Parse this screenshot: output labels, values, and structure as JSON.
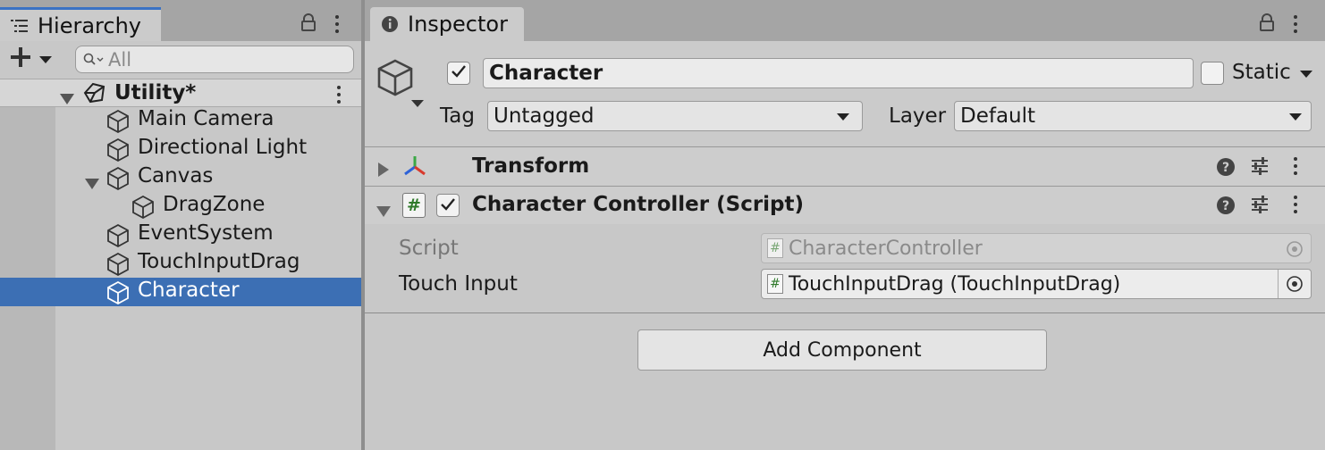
{
  "hierarchy": {
    "tab_label": "Hierarchy",
    "search_placeholder": "All",
    "scene_name": "Utility*",
    "items": [
      {
        "label": "Main Camera"
      },
      {
        "label": "Directional Light"
      },
      {
        "label": "Canvas"
      },
      {
        "label": "DragZone"
      },
      {
        "label": "EventSystem"
      },
      {
        "label": "TouchInputDrag"
      },
      {
        "label": "Character"
      }
    ]
  },
  "inspector": {
    "tab_label": "Inspector",
    "object_name": "Character",
    "static_label": "Static",
    "tag_label": "Tag",
    "tag_value": "Untagged",
    "layer_label": "Layer",
    "layer_value": "Default",
    "components": [
      {
        "name": "Transform"
      },
      {
        "name": "Character Controller (Script)"
      }
    ],
    "script_label": "Script",
    "script_value": "CharacterController",
    "touch_input_label": "Touch Input",
    "touch_input_value": "TouchInputDrag (TouchInputDrag)",
    "add_component_label": "Add Component"
  },
  "colors": {
    "selection": "#3c6fb4",
    "panel_bg": "#c8c8c8",
    "tab_accent": "#3a72c4"
  }
}
